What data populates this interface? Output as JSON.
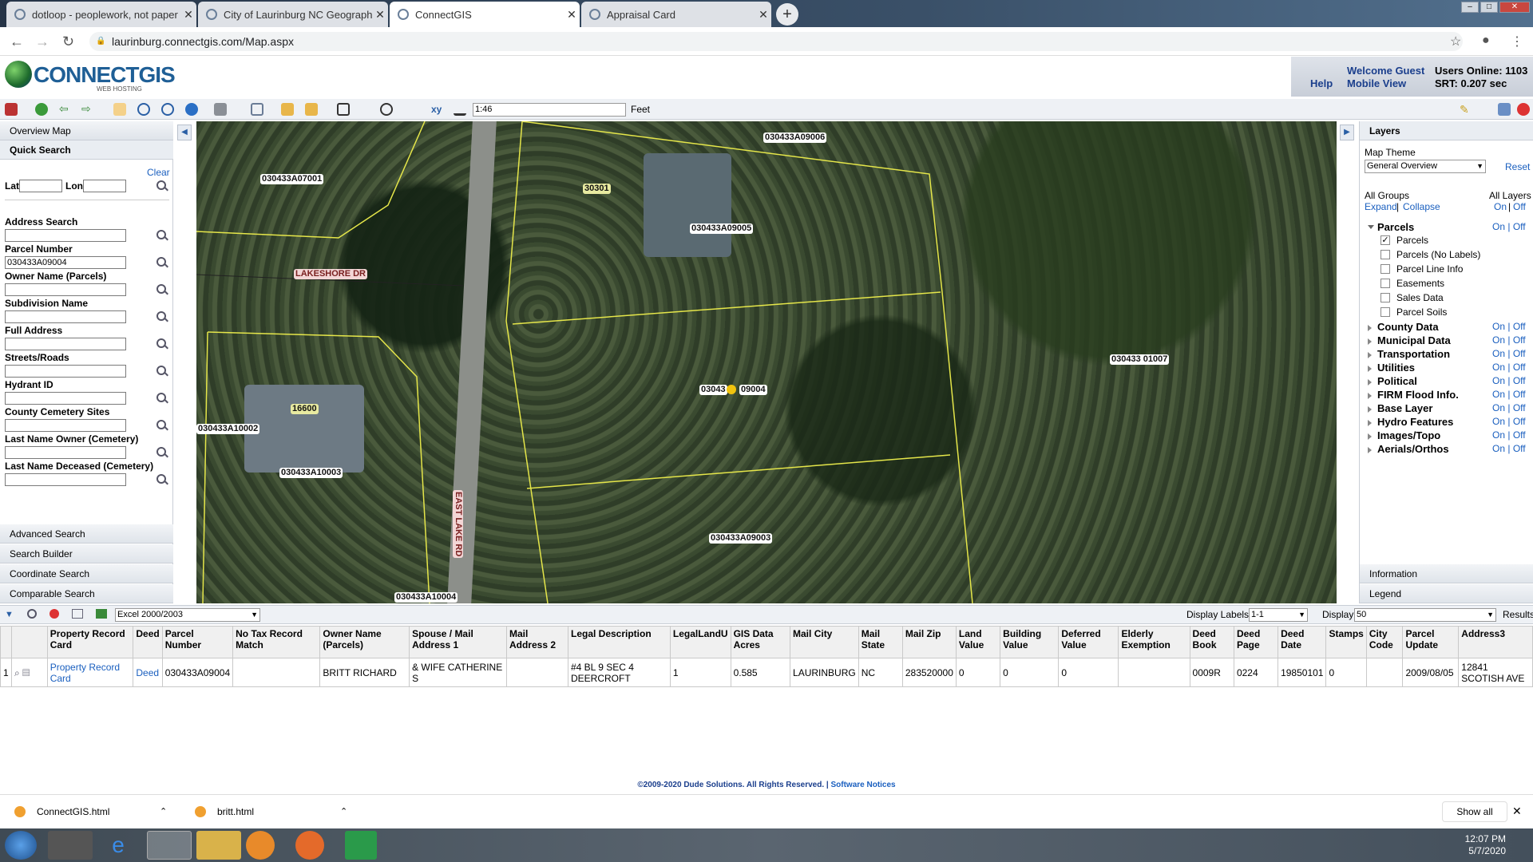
{
  "browser": {
    "tabs": [
      {
        "title": "dotloop - peoplework, not paper",
        "active": false
      },
      {
        "title": "City of Laurinburg NC Geographic",
        "active": false
      },
      {
        "title": "ConnectGIS",
        "active": true
      },
      {
        "title": "Appraisal Card",
        "active": false
      }
    ],
    "url": "laurinburg.connectgis.com/Map.aspx"
  },
  "header": {
    "logo": "CONNECTGIS",
    "logo_sub": "WEB HOSTING",
    "welcome": "Welcome Guest",
    "help": "Help",
    "mobile": "Mobile View",
    "users_online": "Users Online: 1103",
    "srt": "SRT: 0.207 sec"
  },
  "toolbar": {
    "scale": "1:46",
    "unit": "Feet"
  },
  "left": {
    "overview": "Overview Map",
    "quick_search": "Quick Search",
    "clear": "Clear",
    "lat": "Lat",
    "lon": "Lon",
    "fields": [
      {
        "label": "Address Search",
        "value": ""
      },
      {
        "label": "Parcel Number",
        "value": "030433A09004"
      },
      {
        "label": "Owner Name (Parcels)",
        "value": ""
      },
      {
        "label": "Subdivision Name",
        "value": ""
      },
      {
        "label": "Full Address",
        "value": ""
      },
      {
        "label": "Streets/Roads",
        "value": ""
      },
      {
        "label": "Hydrant ID",
        "value": ""
      },
      {
        "label": "County Cemetery Sites",
        "value": ""
      },
      {
        "label": "Last Name Owner (Cemetery)",
        "value": ""
      },
      {
        "label": "Last Name Deceased (Cemetery)",
        "value": ""
      }
    ],
    "sections": [
      "Advanced Search",
      "Search Builder",
      "Coordinate Search",
      "Comparable Search"
    ]
  },
  "map": {
    "labels": [
      "030433A07001",
      "030433A09006",
      "30301",
      "030433A09005",
      "LAKESHORE DR",
      "030433 01007",
      "03043",
      "09004",
      "16600",
      "030433A10002",
      "030433A10003",
      "EAST LAKE RD",
      "030433A09003",
      "030433A10004"
    ]
  },
  "right": {
    "title": "Layers",
    "theme_label": "Map Theme",
    "theme_value": "General Overview",
    "reset": "Reset",
    "all_groups": "All Groups",
    "all_layers": "All Layers",
    "expand": "Expand",
    "sep": "|",
    "collapse": "Collapse",
    "on": "On",
    "off": "Off",
    "parcels_group": "Parcels",
    "parcel_layers": [
      {
        "label": "Parcels",
        "checked": "✓"
      },
      {
        "label": "Parcels (No Labels)",
        "checked": ""
      },
      {
        "label": "Parcel Line Info",
        "checked": ""
      },
      {
        "label": "Easements",
        "checked": ""
      },
      {
        "label": "Sales Data",
        "checked": ""
      },
      {
        "label": "Parcel Soils",
        "checked": ""
      }
    ],
    "groups": [
      "County Data",
      "Municipal Data",
      "Transportation",
      "Utilities",
      "Political",
      "FIRM Flood Info.",
      "Base Layer",
      "Hydro Features",
      "Images/Topo",
      "Aerials/Orthos"
    ],
    "information": "Information",
    "legend": "Legend"
  },
  "grid": {
    "export": "Excel 2000/2003",
    "display_labels": "Display Labels",
    "display_labels_value": "1-1",
    "display": "Display",
    "display_value": "50",
    "results": "Results",
    "columns": [
      "",
      "",
      "Property Record Card",
      "Deed",
      "Parcel Number",
      "No Tax Record Match",
      "Owner Name (Parcels)",
      "Spouse / Mail Address 1",
      "Mail Address 2",
      "Legal Description",
      "LegalLandU",
      "GIS Data Acres",
      "Mail City",
      "Mail State",
      "Mail Zip",
      "Land Value",
      "Building Value",
      "Deferred Value",
      "Elderly Exemption",
      "Deed Book",
      "Deed Page",
      "Deed Date",
      "Stamps",
      "City Code",
      "Parcel Update",
      "Address3"
    ],
    "row": [
      "1",
      "",
      "Property Record Card",
      "Deed",
      "030433A09004",
      "",
      "BRITT RICHARD",
      "& WIFE CATHERINE S",
      "",
      "#4 BL 9 SEC 4 DEERCROFT",
      "1",
      "0.585",
      "LAURINBURG",
      "NC",
      "283520000",
      "0",
      "0",
      "0",
      "",
      "0009R",
      "0224",
      "19850101",
      "0",
      "",
      "2009/08/05",
      "12841 SCOTISH AVE"
    ]
  },
  "footer": {
    "copyright": "©2009-2020 Dude Solutions. All Rights Reserved.",
    "sep": "|",
    "notices": "Software Notices"
  },
  "downloads": [
    {
      "name": "ConnectGIS.html"
    },
    {
      "name": "britt.html"
    }
  ],
  "download_bar": {
    "show_all": "Show all"
  },
  "taskbar": {
    "time": "12:07 PM",
    "date": "5/7/2020"
  }
}
